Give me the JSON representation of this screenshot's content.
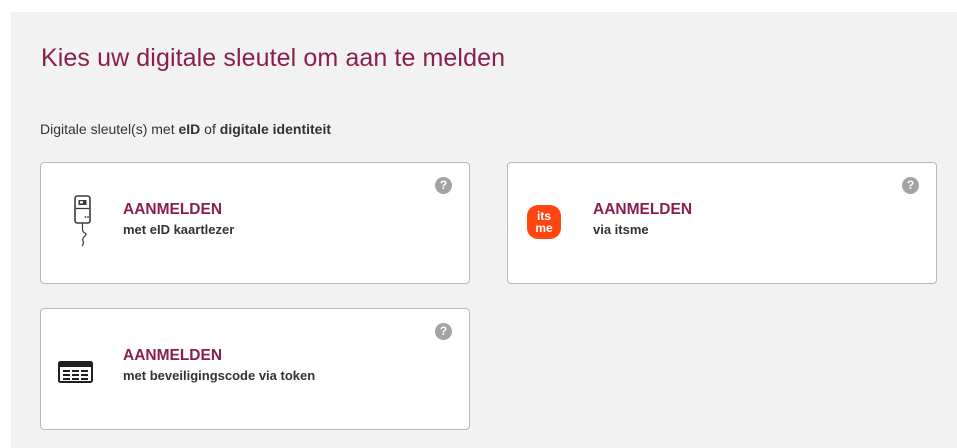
{
  "heading": "Kies uw digitale sleutel om aan te melden",
  "intro": {
    "prefix": "Digitale sleutel(s) met ",
    "bold1": "eID",
    "middle": " of ",
    "bold2": "digitale identiteit"
  },
  "help_glyph": "?",
  "cards": [
    {
      "icon": "eid-card-reader-icon",
      "main": "AANMELDEN",
      "sub": "met eID kaartlezer"
    },
    {
      "icon": "itsme-logo-icon",
      "logo_text_top": "its",
      "logo_text_bottom": "me",
      "main": "AANMELDEN",
      "sub": "via itsme"
    },
    {
      "icon": "security-token-icon",
      "main": "AANMELDEN",
      "sub": "met beveiligingscode via token"
    }
  ],
  "colors": {
    "accent": "#8a1f4d",
    "panel_background": "#f2f2f2",
    "itsme_orange": "#ff4612",
    "help_icon": "#a3a3a3"
  }
}
